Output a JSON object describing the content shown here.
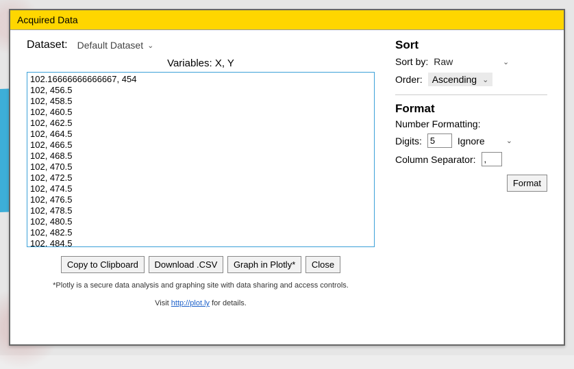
{
  "title": "Acquired Data",
  "dataset": {
    "label": "Dataset:",
    "selected": "Default Dataset"
  },
  "variables_label": "Variables: X, Y",
  "data_lines": [
    "102.16666666666667, 454",
    "102, 456.5",
    "102, 458.5",
    "102, 460.5",
    "102, 462.5",
    "102, 464.5",
    "102, 466.5",
    "102, 468.5",
    "102, 470.5",
    "102, 472.5",
    "102, 474.5",
    "102, 476.5",
    "102, 478.5",
    "102, 480.5",
    "102, 482.5",
    "102, 484.5"
  ],
  "buttons": {
    "copy": "Copy to Clipboard",
    "download": "Download .CSV",
    "graph": "Graph in Plotly*",
    "close": "Close"
  },
  "footnote": "*Plotly is a secure data analysis and graphing site with data sharing and access controls.",
  "footnote2_pre": "Visit ",
  "footnote2_link": "http://plot.ly",
  "footnote2_post": " for details.",
  "sort": {
    "header": "Sort",
    "sortby_label": "Sort by:",
    "sortby_value": "Raw",
    "order_label": "Order:",
    "order_value": "Ascending"
  },
  "format": {
    "header": "Format",
    "numformat_label": "Number Formatting:",
    "digits_label": "Digits:",
    "digits_value": "5",
    "digits_mode": "Ignore",
    "colsep_label": "Column Separator:",
    "colsep_value": ", ",
    "format_button": "Format"
  }
}
